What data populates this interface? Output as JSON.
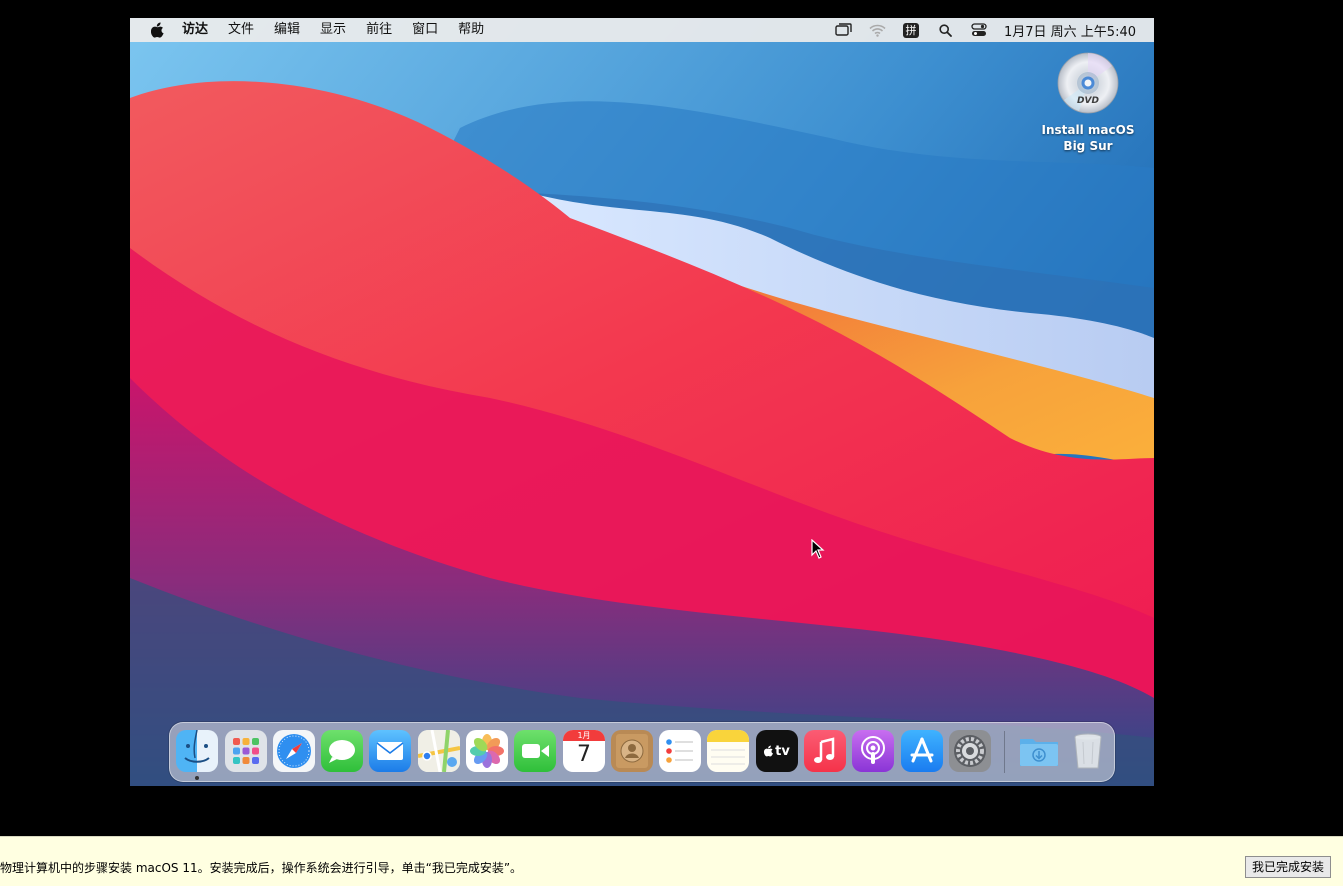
{
  "menubar": {
    "app_name": "访达",
    "items": [
      "文件",
      "编辑",
      "显示",
      "前往",
      "窗口",
      "帮助"
    ],
    "input_method": "拼",
    "clock": "1月7日 周六 上午5:40"
  },
  "desktop": {
    "icons": [
      {
        "label": "Install macOS Big Sur",
        "icon": "dvd-disc-icon",
        "disc_text": "DVD"
      }
    ]
  },
  "dock": {
    "apps": [
      {
        "name": "finder",
        "icon": "finder-icon",
        "running": true
      },
      {
        "name": "launchpad",
        "icon": "launchpad-icon"
      },
      {
        "name": "safari",
        "icon": "safari-icon"
      },
      {
        "name": "messages",
        "icon": "messages-icon"
      },
      {
        "name": "mail",
        "icon": "mail-icon"
      },
      {
        "name": "maps",
        "icon": "maps-icon"
      },
      {
        "name": "photos",
        "icon": "photos-icon"
      },
      {
        "name": "facetime",
        "icon": "facetime-icon"
      },
      {
        "name": "calendar",
        "icon": "calendar-icon",
        "month": "1月",
        "day": "7"
      },
      {
        "name": "contacts",
        "icon": "contacts-icon"
      },
      {
        "name": "reminders",
        "icon": "reminders-icon"
      },
      {
        "name": "notes",
        "icon": "notes-icon"
      },
      {
        "name": "apple-tv",
        "icon": "apple-tv-icon",
        "text": "tv"
      },
      {
        "name": "music",
        "icon": "music-icon"
      },
      {
        "name": "podcasts",
        "icon": "podcasts-icon"
      },
      {
        "name": "app-store",
        "icon": "app-store-icon"
      },
      {
        "name": "system-preferences",
        "icon": "gear-icon"
      }
    ],
    "stack_items": [
      {
        "name": "downloads",
        "icon": "downloads-folder-icon"
      },
      {
        "name": "trash",
        "icon": "trash-icon"
      }
    ]
  },
  "infobar": {
    "message": "物理计算机中的步骤安装 macOS 11。安装完成后，操作系统会进行引导，单击“我已完成安装”。",
    "done_button": "我已完成安装"
  },
  "colors": {
    "menubar_bg": "#ececec",
    "infobar_bg": "#ffffe1",
    "wallpaper_blue": "#1f6fb8",
    "wallpaper_red": "#f0184a",
    "wallpaper_orange": "#f7a23b",
    "wallpaper_purple": "#5a3d8a"
  }
}
